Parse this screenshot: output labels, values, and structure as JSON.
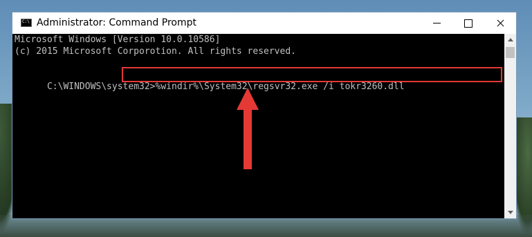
{
  "window": {
    "title": "Administrator: Command Prompt",
    "icon": "cmd-icon"
  },
  "console": {
    "line1": "Microsoft Windows [Version 10.0.10586]",
    "line2": "(c) 2015 Microsoft Corporotion. All rights reserved.",
    "prompt": "C:\\WINDOWS\\system32>",
    "command": "%windir%\\System32\\regsvr32.exe /i tokr3260.dll"
  },
  "annotation": {
    "highlight_color": "#e53935",
    "arrow_color": "#e53935"
  },
  "controls": {
    "minimize_icon": "minimize-icon",
    "maximize_icon": "maximize-icon",
    "close_icon": "close-icon"
  }
}
